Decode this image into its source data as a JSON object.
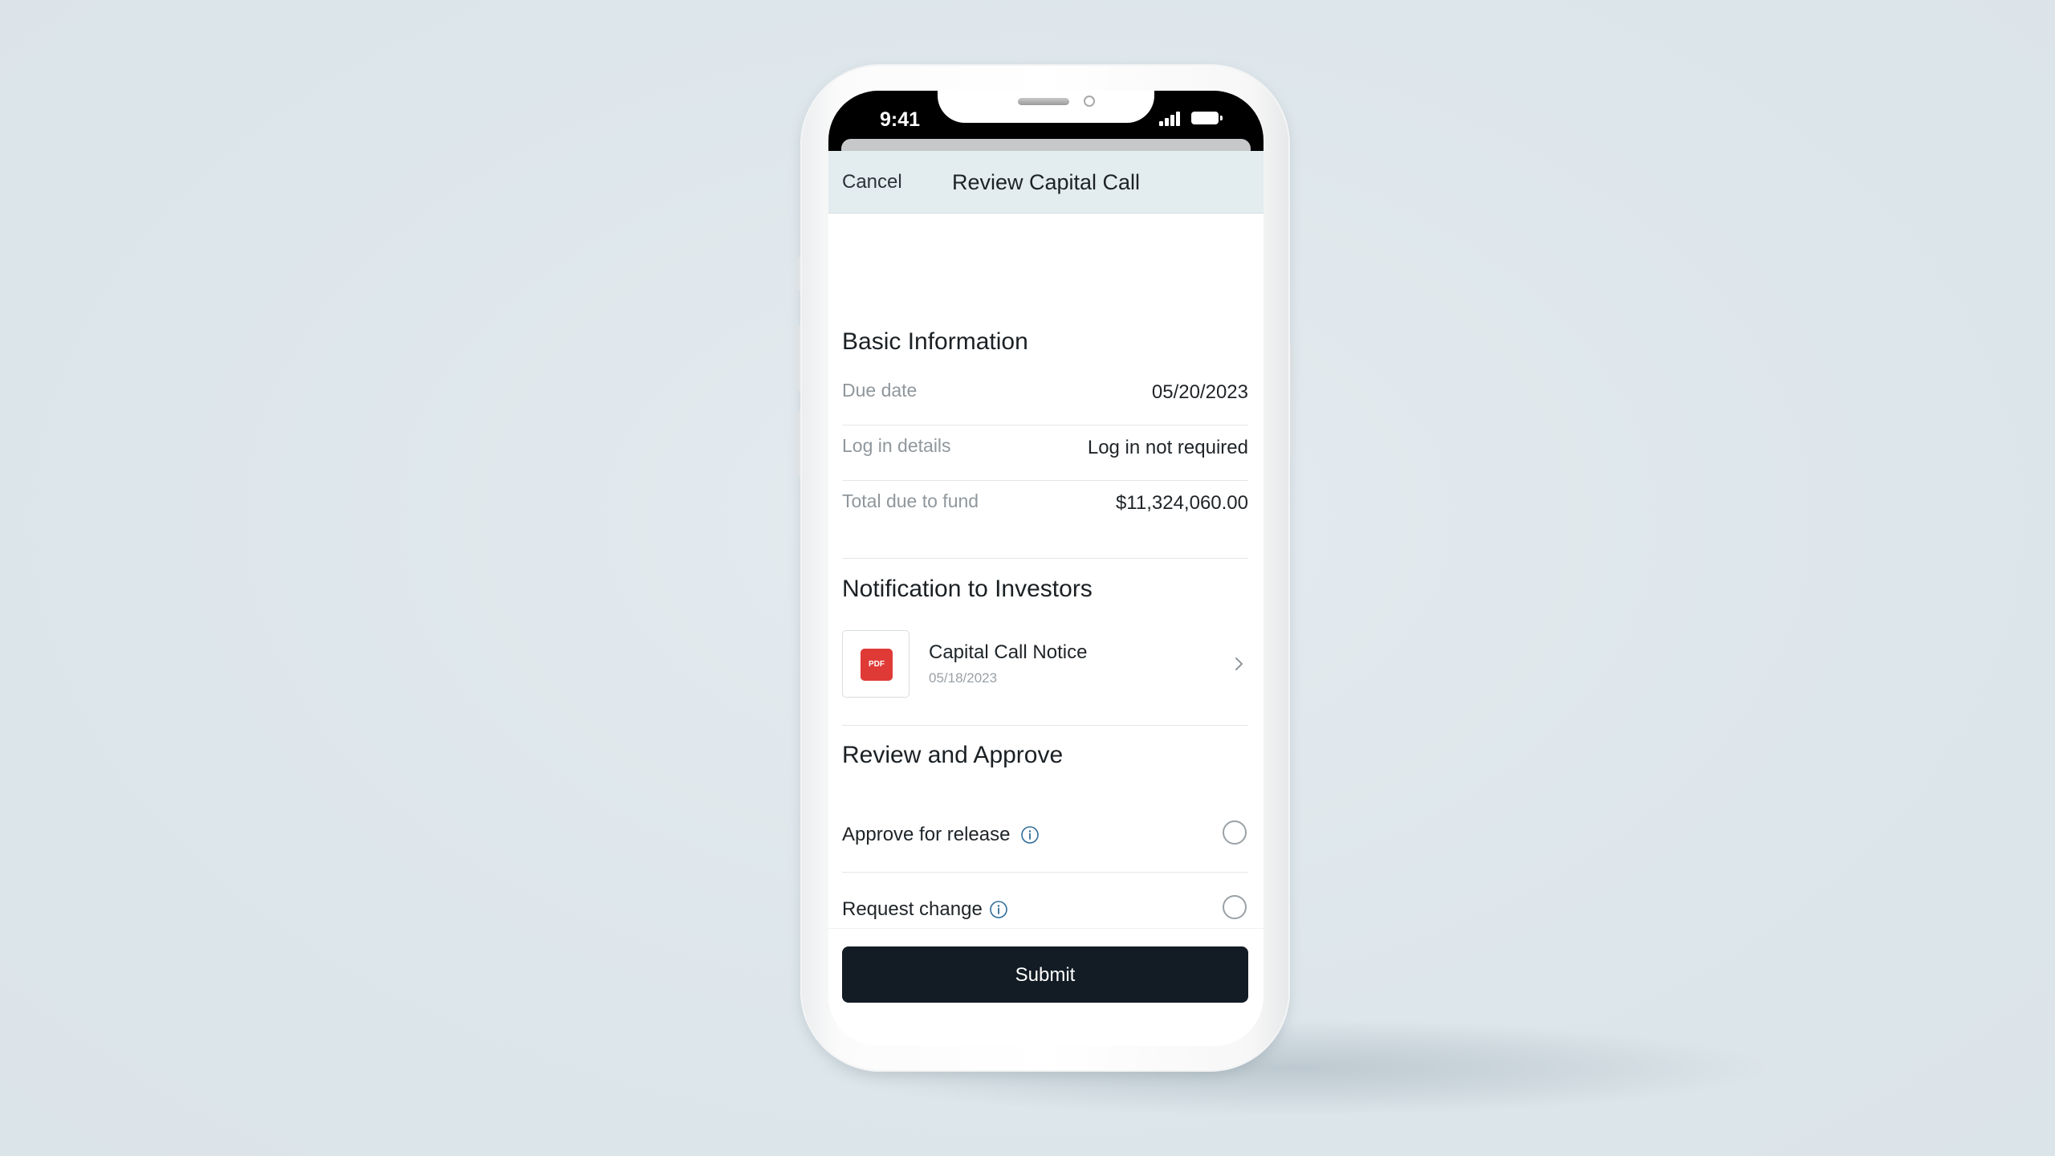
{
  "status_bar": {
    "time": "9:41"
  },
  "nav": {
    "cancel_label": "Cancel",
    "title": "Review Capital Call"
  },
  "basic_info": {
    "title": "Basic Information",
    "rows": [
      {
        "label": "Due date",
        "value": "05/20/2023"
      },
      {
        "label": "Log in details",
        "value": "Log in not required"
      },
      {
        "label": "Total due to fund",
        "value": "$11,324,060.00"
      }
    ]
  },
  "notification": {
    "title": "Notification to Investors",
    "document": {
      "badge": "PDF",
      "name": "Capital Call Notice",
      "date": "05/18/2023",
      "icon": "chevron-right-icon"
    }
  },
  "review": {
    "title": "Review and Approve",
    "options": [
      {
        "label": "Approve for release",
        "selected": false,
        "icon": "info-icon"
      },
      {
        "label": "Request change",
        "selected": false,
        "icon": "info-icon"
      }
    ]
  },
  "footer": {
    "submit_label": "Submit"
  },
  "colors": {
    "background": "#dfe7ec",
    "nav_bar": "#e3ecef",
    "submit_button": "#131c24",
    "pdf_badge": "#e03a37",
    "info_icon": "#2f6d9a"
  }
}
